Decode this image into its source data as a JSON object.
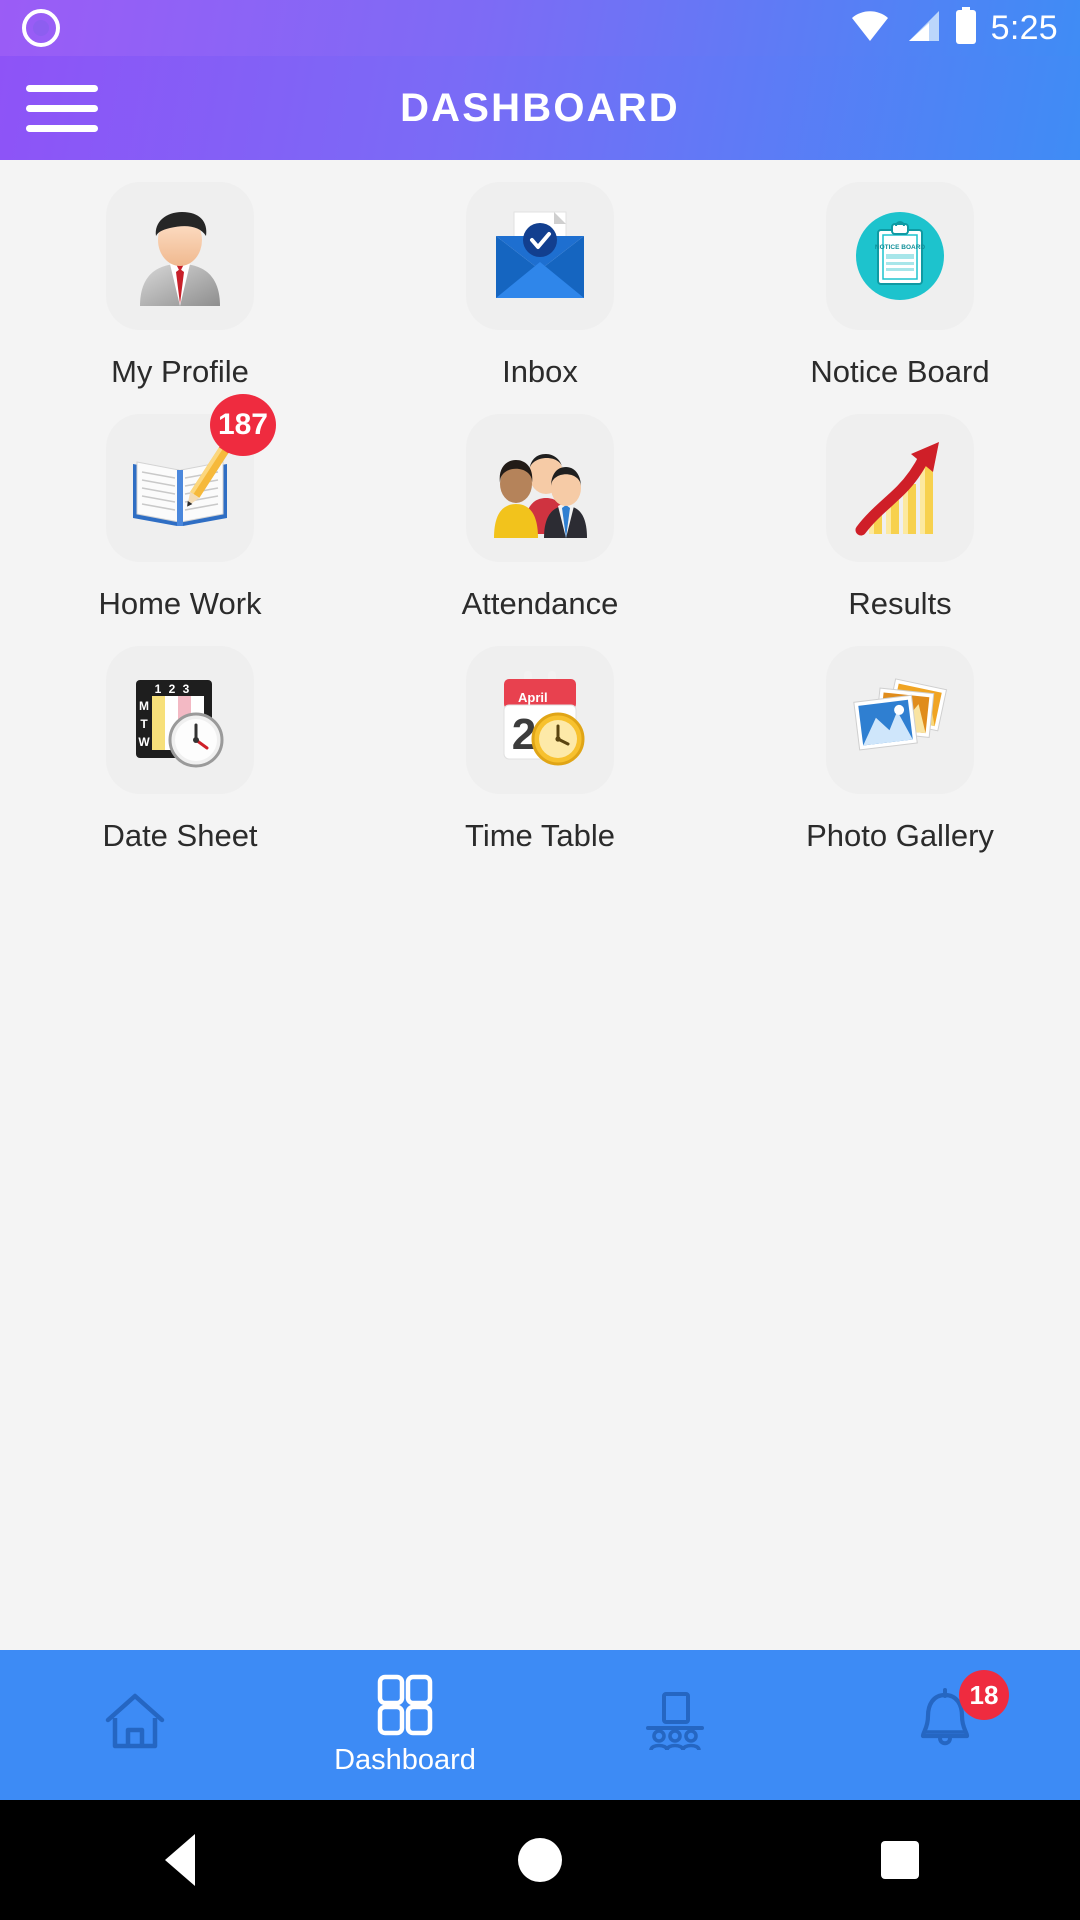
{
  "status_bar": {
    "time": "5:25",
    "icons": [
      "record-indicator-icon",
      "wifi-icon",
      "cellular-signal-icon",
      "battery-icon"
    ]
  },
  "app_bar": {
    "title": "DASHBOARD",
    "menu_icon": "hamburger-menu-icon",
    "gradient_start": "#8e53f7",
    "gradient_end": "#3f8cf5"
  },
  "grid": {
    "items": [
      {
        "label": "My Profile",
        "icon": "businessman-avatar-icon",
        "badge": null
      },
      {
        "label": "Inbox",
        "icon": "envelope-check-icon",
        "badge": null
      },
      {
        "label": "Notice Board",
        "icon": "clipboard-notice-board-icon",
        "badge": null,
        "icon_text": "NOTICE BOARD"
      },
      {
        "label": "Home Work",
        "icon": "open-book-pencil-icon",
        "badge": "187"
      },
      {
        "label": "Attendance",
        "icon": "people-group-icon",
        "badge": null
      },
      {
        "label": "Results",
        "icon": "bar-chart-arrow-icon",
        "badge": null
      },
      {
        "label": "Date Sheet",
        "icon": "schedule-clock-icon",
        "badge": null,
        "icon_text": "1 2 3"
      },
      {
        "label": "Time Table",
        "icon": "calendar-clock-icon",
        "badge": null,
        "icon_text": "April"
      },
      {
        "label": "Photo Gallery",
        "icon": "photo-stack-icon",
        "badge": null
      }
    ]
  },
  "bottom_nav": {
    "items": [
      {
        "label": "",
        "icon": "home-icon",
        "active": false,
        "badge": null
      },
      {
        "label": "Dashboard",
        "icon": "grid-icon",
        "active": true,
        "badge": null
      },
      {
        "label": "",
        "icon": "classroom-icon",
        "active": false,
        "badge": null
      },
      {
        "label": "",
        "icon": "bell-icon",
        "active": false,
        "badge": "18"
      }
    ],
    "background": "#3d8bf5",
    "active_color": "#ffffff",
    "inactive_color": "#2566c2"
  },
  "android_nav": {
    "back": "back-triangle-icon",
    "home": "home-circle-icon",
    "recents": "recents-square-icon"
  }
}
